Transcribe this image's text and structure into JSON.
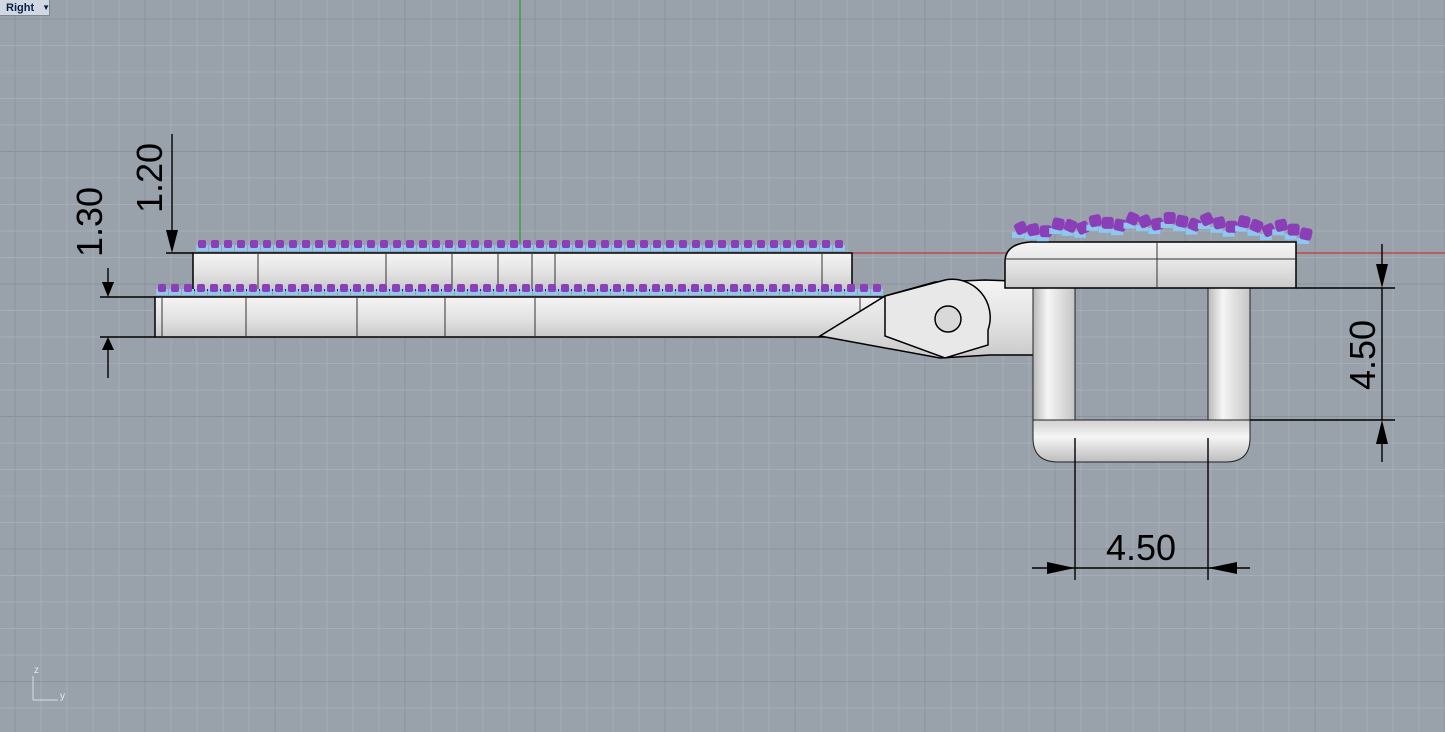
{
  "viewport": {
    "name": "Right",
    "dropdown_icon": "chevron-down-icon"
  },
  "dimensions": {
    "top_stone_height": "1.20",
    "base_height": "1.30",
    "bail_height": "4.50",
    "bail_width": "4.50"
  },
  "axis_widget": {
    "vertical_label": "z",
    "horizontal_label": "y"
  },
  "colors": {
    "background": "#99a1ab",
    "grid_minor": "#a6adb6",
    "grid_major": "#8a929c",
    "axis_green": "#2e9a2e",
    "axis_red": "#c0393b",
    "metal": "#e6e6e6",
    "stone_purple": "#8a3fb8",
    "stone_blue": "#8ec8f0",
    "dimension": "#000000"
  }
}
